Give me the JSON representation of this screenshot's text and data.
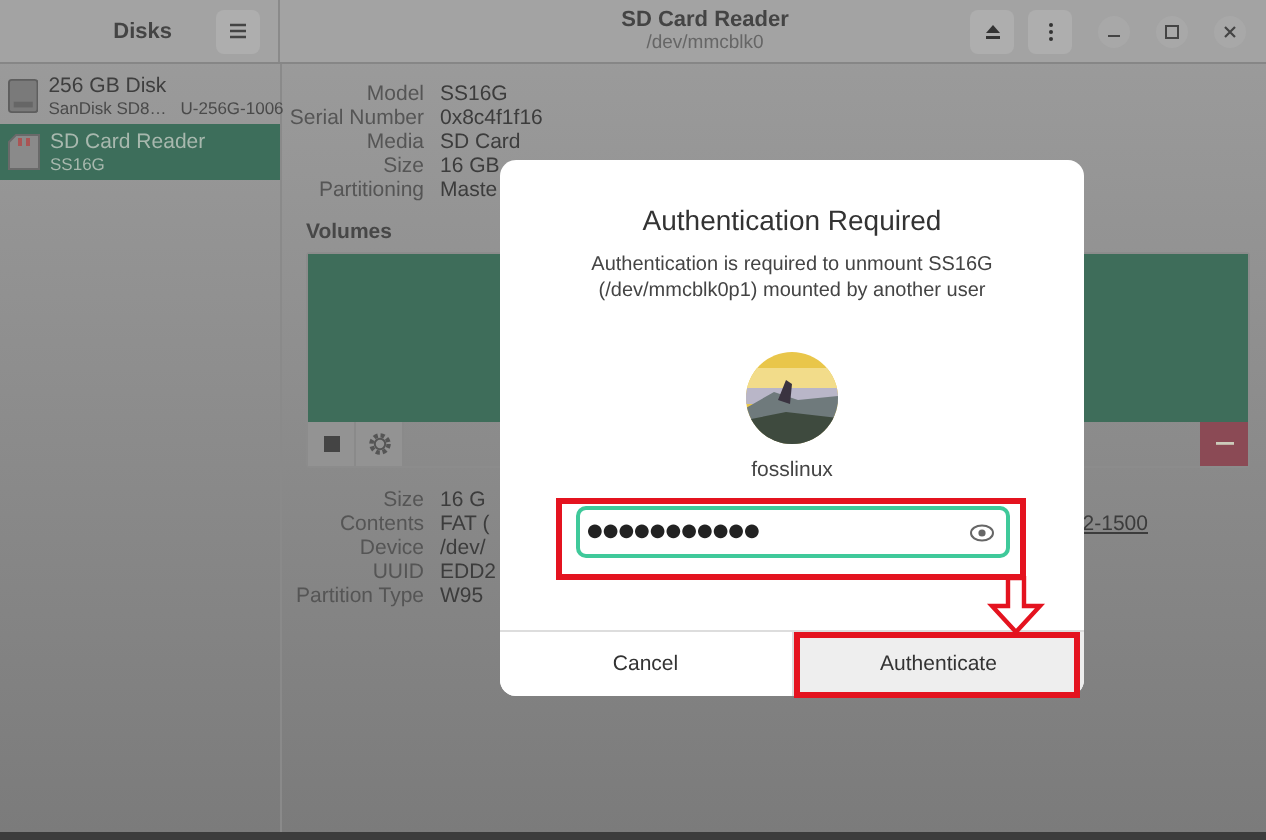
{
  "header": {
    "sidebar_title": "Disks",
    "title": "SD Card Reader",
    "subtitle": "/dev/mmcblk0"
  },
  "sidebar": {
    "items": [
      {
        "kind": "disk",
        "name": "256 GB Disk",
        "model": "SanDisk SD8…",
        "serial": "U-256G-1006",
        "selected": false
      },
      {
        "kind": "card",
        "name": "SD Card Reader",
        "model": "SS16G",
        "selected": true
      }
    ]
  },
  "drive_details": [
    {
      "label": "Model",
      "value": "SS16G"
    },
    {
      "label": "Serial Number",
      "value": "0x8c4f1f16"
    },
    {
      "label": "Media",
      "value": "SD Card"
    },
    {
      "label": "Size",
      "value": "16 GB"
    },
    {
      "label": "Partitioning",
      "value": "Maste"
    }
  ],
  "volumes": {
    "title": "Volumes"
  },
  "volume_details": [
    {
      "label": "Size",
      "value": "16 G"
    },
    {
      "label": "Contents",
      "value": "FAT (",
      "link": "2-1500"
    },
    {
      "label": "Device",
      "value": "/dev/"
    },
    {
      "label": "UUID",
      "value": "EDD2"
    },
    {
      "label": "Partition Type",
      "value": "W95"
    }
  ],
  "dialog": {
    "title": "Authentication Required",
    "message": "Authentication is required to unmount SS16G (/dev/mmcblk0p1) mounted by another user",
    "user": "fosslinux",
    "password": "●●●●●●●●●●●",
    "buttons": [
      "Cancel",
      "Authenticate"
    ]
  }
}
